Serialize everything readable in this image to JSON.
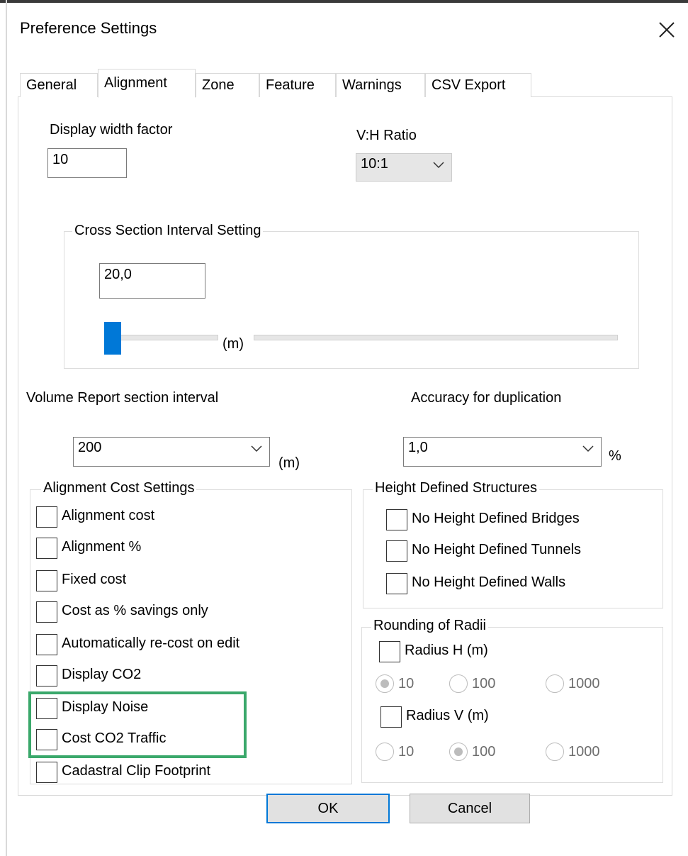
{
  "window": {
    "title": "Preference Settings",
    "close_icon": "close-icon"
  },
  "tabs": [
    {
      "label": "General",
      "active": false
    },
    {
      "label": "Alignment",
      "active": true
    },
    {
      "label": "Zone",
      "active": false
    },
    {
      "label": "Feature",
      "active": false
    },
    {
      "label": "Warnings",
      "active": false
    },
    {
      "label": "CSV Export",
      "active": false
    }
  ],
  "alignment": {
    "display_width_factor": {
      "label": "Display width factor",
      "value": "10"
    },
    "vh_ratio": {
      "label": "V:H Ratio",
      "value": "10:1"
    },
    "cross_section": {
      "title": "Cross Section Interval Setting",
      "value": "20,0",
      "unit": "(m)",
      "slider_level": 0
    },
    "volume_report": {
      "label": "Volume Report section interval",
      "value": "200",
      "unit": "(m)"
    },
    "accuracy": {
      "label": "Accuracy for duplication",
      "value": "1,0",
      "unit": "%"
    },
    "cost_settings": {
      "title": "Alignment Cost Settings",
      "items": [
        {
          "label": "Alignment cost",
          "checked": false
        },
        {
          "label": "Alignment %",
          "checked": false
        },
        {
          "label": "Fixed cost",
          "checked": false
        },
        {
          "label": "Cost as % savings only",
          "checked": false
        },
        {
          "label": "Automatically re-cost on edit",
          "checked": false
        },
        {
          "label": "Display CO2",
          "checked": false
        },
        {
          "label": "Display Noise",
          "checked": false
        },
        {
          "label": "Cost CO2 Traffic",
          "checked": false
        },
        {
          "label": "Cadastral Clip Footprint",
          "checked": false
        }
      ],
      "highlight_color": "#3aa86b"
    },
    "height_structures": {
      "title": "Height Defined Structures",
      "items": [
        {
          "label": "No Height Defined Bridges",
          "checked": false
        },
        {
          "label": "No Height Defined Tunnels",
          "checked": false
        },
        {
          "label": "No Height Defined Walls",
          "checked": false
        }
      ]
    },
    "rounding": {
      "title": "Rounding of Radii",
      "radius_h": {
        "label": "Radius H (m)",
        "checked": false,
        "options": [
          "10",
          "100",
          "1000"
        ],
        "selected": "10"
      },
      "radius_v": {
        "label": "Radius V (m)",
        "checked": false,
        "options": [
          "10",
          "100",
          "1000"
        ],
        "selected": "100"
      }
    }
  },
  "buttons": {
    "ok": "OK",
    "cancel": "Cancel"
  },
  "colors": {
    "accent": "#0078d7",
    "highlight": "#3aa86b"
  }
}
